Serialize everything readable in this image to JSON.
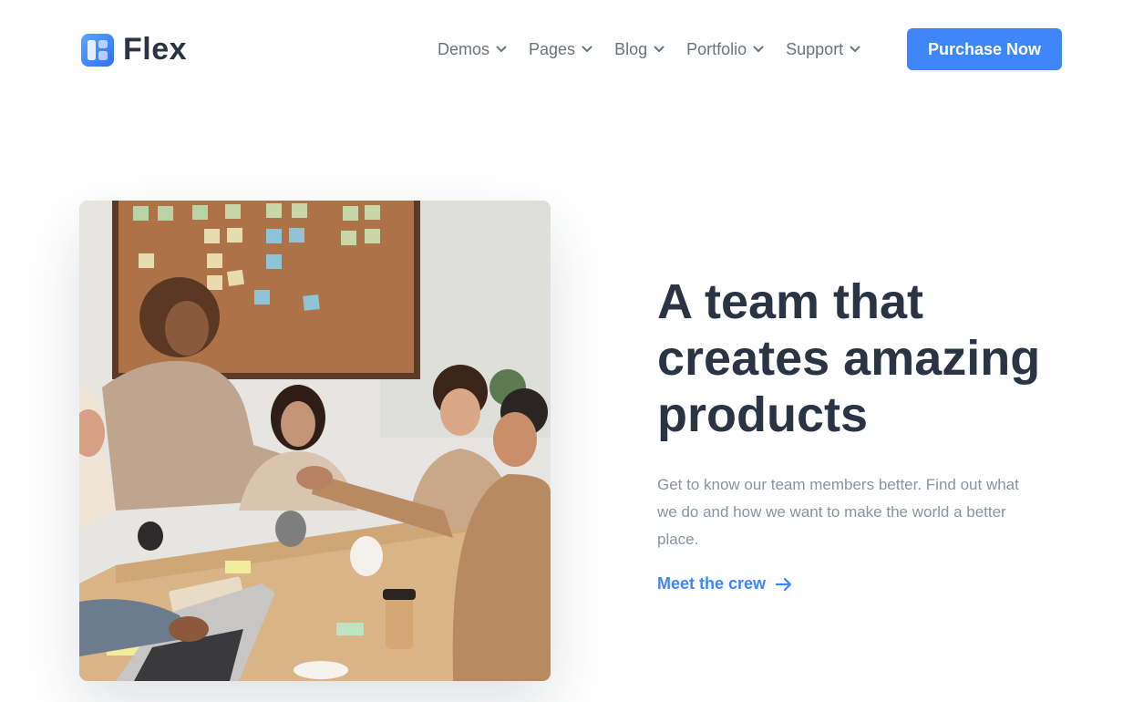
{
  "brand": {
    "name": "Flex",
    "logo_icon": "flex-logo-icon"
  },
  "nav": {
    "items": [
      {
        "label": "Demos",
        "icon": "chevron-down-icon"
      },
      {
        "label": "Pages",
        "icon": "chevron-down-icon"
      },
      {
        "label": "Blog",
        "icon": "chevron-down-icon"
      },
      {
        "label": "Portfolio",
        "icon": "chevron-down-icon"
      },
      {
        "label": "Support",
        "icon": "chevron-down-icon"
      }
    ],
    "cta_label": "Purchase Now"
  },
  "hero": {
    "image_subject": "team-meeting-photo",
    "headline": "A team that creates amazing products",
    "description": "Get to know our team members better. Find out what we do and how we want to make the world a better place.",
    "link_label": "Meet the crew",
    "link_icon": "arrow-right-icon"
  },
  "colors": {
    "accent": "#3f86fb",
    "heading": "#2b3445",
    "nav_text": "#6b7380",
    "body_text": "#8a93a3"
  }
}
